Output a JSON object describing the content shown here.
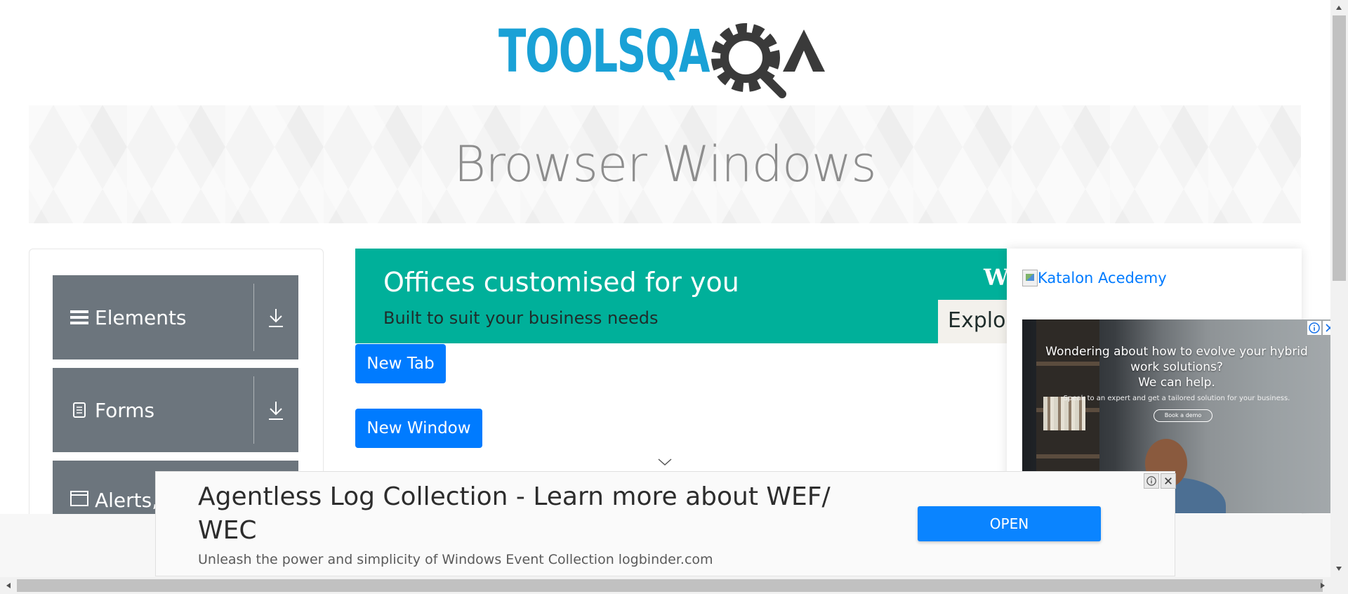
{
  "header": {
    "logo_text": "TOOLSQA"
  },
  "banner": {
    "title": "Browser Windows"
  },
  "sidebar": {
    "items": [
      {
        "label": "Elements"
      },
      {
        "label": "Forms"
      },
      {
        "label": "Alerts,"
      }
    ]
  },
  "ad_top": {
    "title": "Offices customised for you",
    "subtitle": "Built to suit your business needs",
    "brand_letter": "W",
    "cta": "Explo"
  },
  "buttons": {
    "new_tab": "New Tab",
    "new_window": "New Window"
  },
  "right_panel": {
    "link_text": "Katalon Acedemy",
    "ad_line1": "Wondering about how to evolve your hybrid",
    "ad_line2": "work solutions?",
    "ad_line3": "We can help.",
    "ad_small": "Speak to an expert and get a tailored solution for your business.",
    "ad_button": "Book a demo"
  },
  "bottom_ad": {
    "title": "Agentless Log Collection - Learn more about WEF/ WEC",
    "subtitle": "Unleash the power and simplicity of Windows Event Collection logbinder.com",
    "button": "OPEN"
  },
  "colors": {
    "primary": "#007bff",
    "sidebar_item": "#6c757d",
    "ad_teal": "#00b09a",
    "logo_blue": "#1aa1d6",
    "logo_dark": "#3a3a3a"
  }
}
